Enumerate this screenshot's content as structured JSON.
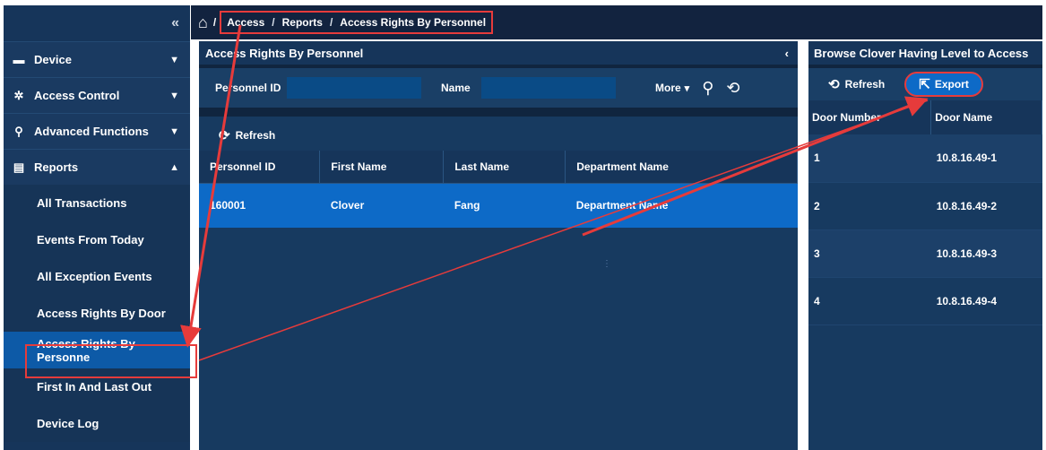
{
  "breadcrumb": {
    "home_icon": "home-icon",
    "sep": "/",
    "items": [
      "Access",
      "Reports",
      "Access Rights By Personnel"
    ]
  },
  "sidebar": {
    "collapse_label": "«",
    "groups": [
      {
        "icon": "device-icon",
        "label": "Device",
        "chevron": "⌄"
      },
      {
        "icon": "gear-icon",
        "label": "Access Control",
        "chevron": "⌄"
      },
      {
        "icon": "advanced-icon",
        "label": "Advanced Functions",
        "chevron": "⌄"
      },
      {
        "icon": "document-icon",
        "label": "Reports",
        "chevron": "˄"
      }
    ],
    "subitems": [
      "All Transactions",
      "Events From Today",
      "All Exception Events",
      "Access Rights By Door",
      "Access Rights By Personne",
      "First In And Last Out",
      "Device Log"
    ],
    "active_index": 4
  },
  "main": {
    "title": "Access Rights By Personnel",
    "collapse_label": "‹",
    "search": {
      "personnel_label": "Personnel ID",
      "personnel_value": "",
      "name_label": "Name",
      "name_value": "",
      "more_label": "More"
    },
    "toolbar": {
      "refresh_label": "Refresh"
    },
    "columns": [
      "Personnel ID",
      "First Name",
      "Last Name",
      "Department Name"
    ],
    "rows": [
      {
        "personnel_id": "160001",
        "first_name": "Clover",
        "last_name": "Fang",
        "department": "Department Name"
      }
    ]
  },
  "right": {
    "title": "Browse Clover Having Level to Access",
    "refresh_label": "Refresh",
    "export_label": "Export",
    "columns": [
      "Door Number",
      "Door Name"
    ],
    "rows": [
      {
        "number": "1",
        "name": "10.8.16.49-1"
      },
      {
        "number": "2",
        "name": "10.8.16.49-2"
      },
      {
        "number": "3",
        "name": "10.8.16.49-3"
      },
      {
        "number": "4",
        "name": "10.8.16.49-4"
      }
    ]
  },
  "colors": {
    "annotation": "#e63b3b",
    "selected": "#0d6ac7",
    "panel": "#173a60",
    "header": "#12233f"
  }
}
